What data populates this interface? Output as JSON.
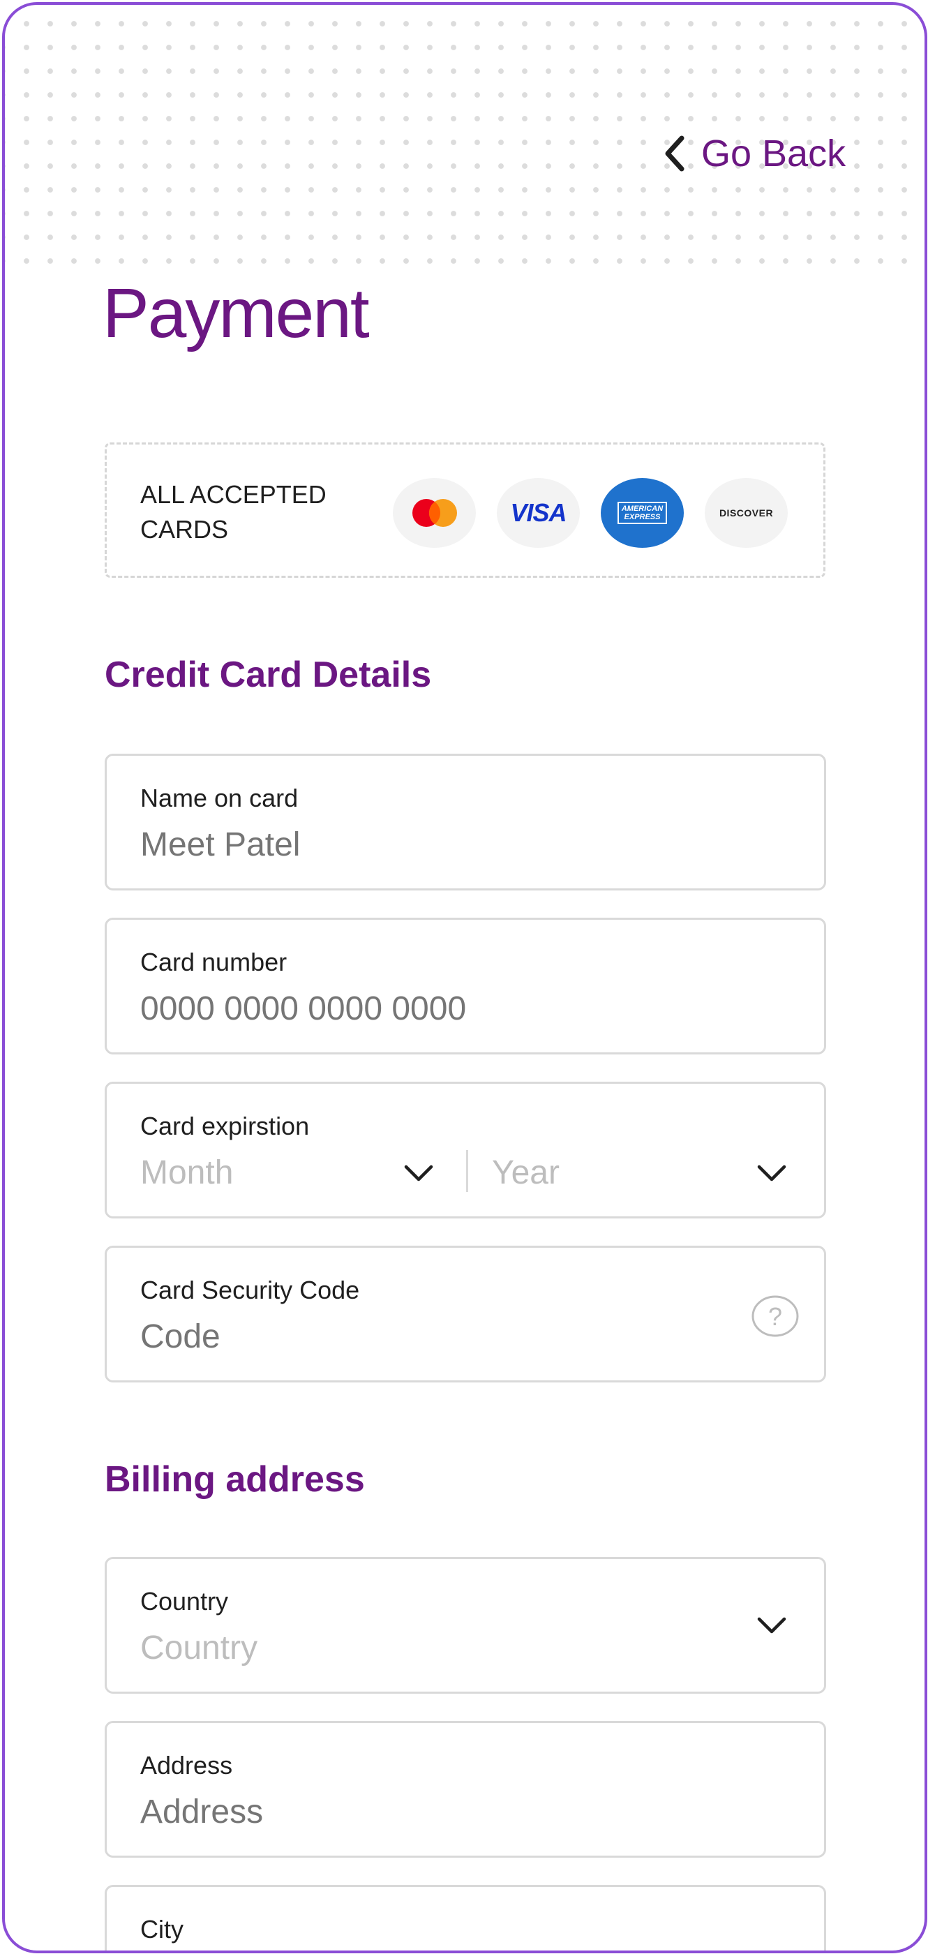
{
  "header": {
    "back_label": "Go Back",
    "title": "Payment"
  },
  "accepted_cards": {
    "label_line1": "ALL ACCEPTED",
    "label_line2": "CARDS",
    "cards": [
      {
        "name": "mastercard",
        "icon": "mastercard-icon"
      },
      {
        "name": "visa",
        "text": "VISA",
        "icon": "visa-icon"
      },
      {
        "name": "american-express",
        "text_line1": "AMERICAN",
        "text_line2": "EXPRESS",
        "icon": "amex-icon"
      },
      {
        "name": "discover",
        "text": "DISCOVER",
        "icon": "discover-icon"
      }
    ]
  },
  "credit_card_section": {
    "title": "Credit Card Details",
    "name_field": {
      "label": "Name on card",
      "placeholder": "Meet Patel"
    },
    "number_field": {
      "label": "Card number",
      "placeholder": "0000 0000 0000 0000"
    },
    "expiration_field": {
      "label": "Card expirstion",
      "month_placeholder": "Month",
      "year_placeholder": "Year"
    },
    "security_field": {
      "label": "Card Security Code",
      "placeholder": "Code"
    }
  },
  "billing_section": {
    "title": "Billing address",
    "country_field": {
      "label": "Country",
      "placeholder": "Country"
    },
    "address_field": {
      "label": "Address",
      "placeholder": "Address"
    },
    "city_field": {
      "label": "City"
    }
  },
  "colors": {
    "accent": "#6b1782",
    "frame_border": "#8a4dd6",
    "placeholder": "#bdbdbd",
    "field_border": "#d9d9d9",
    "amex_blue": "#1f72cd",
    "visa_blue": "#1434cb"
  }
}
